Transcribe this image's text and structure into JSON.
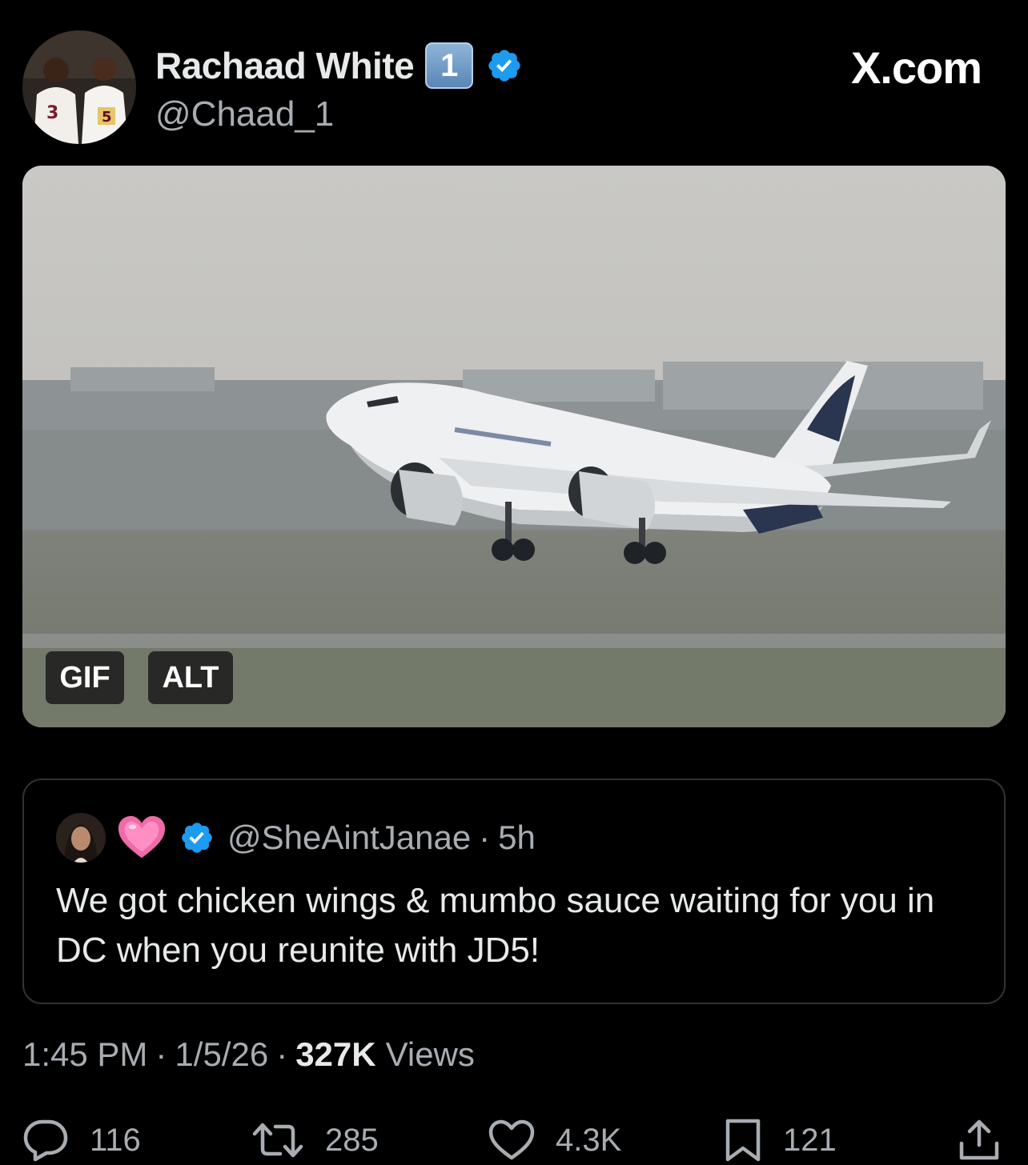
{
  "author": {
    "name": "Rachaad White",
    "badge_emoji": "1",
    "handle": "@Chaad_1",
    "verified_icon": "verified-badge-icon"
  },
  "brand": {
    "label": "X.com"
  },
  "media": {
    "gif_label": "GIF",
    "alt_label": "ALT",
    "subject": "airplane-image"
  },
  "quote": {
    "handle": "@SheAintJanae",
    "separator": "·",
    "time": "5h",
    "text": "We got chicken wings & mumbo sauce waiting for you in DC when you reunite with JD5!"
  },
  "meta": {
    "time": "1:45 PM",
    "date": "1/5/26",
    "separator": "·",
    "views_count": "327K",
    "views_label": "Views"
  },
  "actions": {
    "replies": "116",
    "retweets": "285",
    "likes": "4.3K",
    "bookmarks": "121"
  },
  "colors": {
    "background": "#000000",
    "verified": "#1d9bf0",
    "secondary_text": "#a8adb2"
  }
}
